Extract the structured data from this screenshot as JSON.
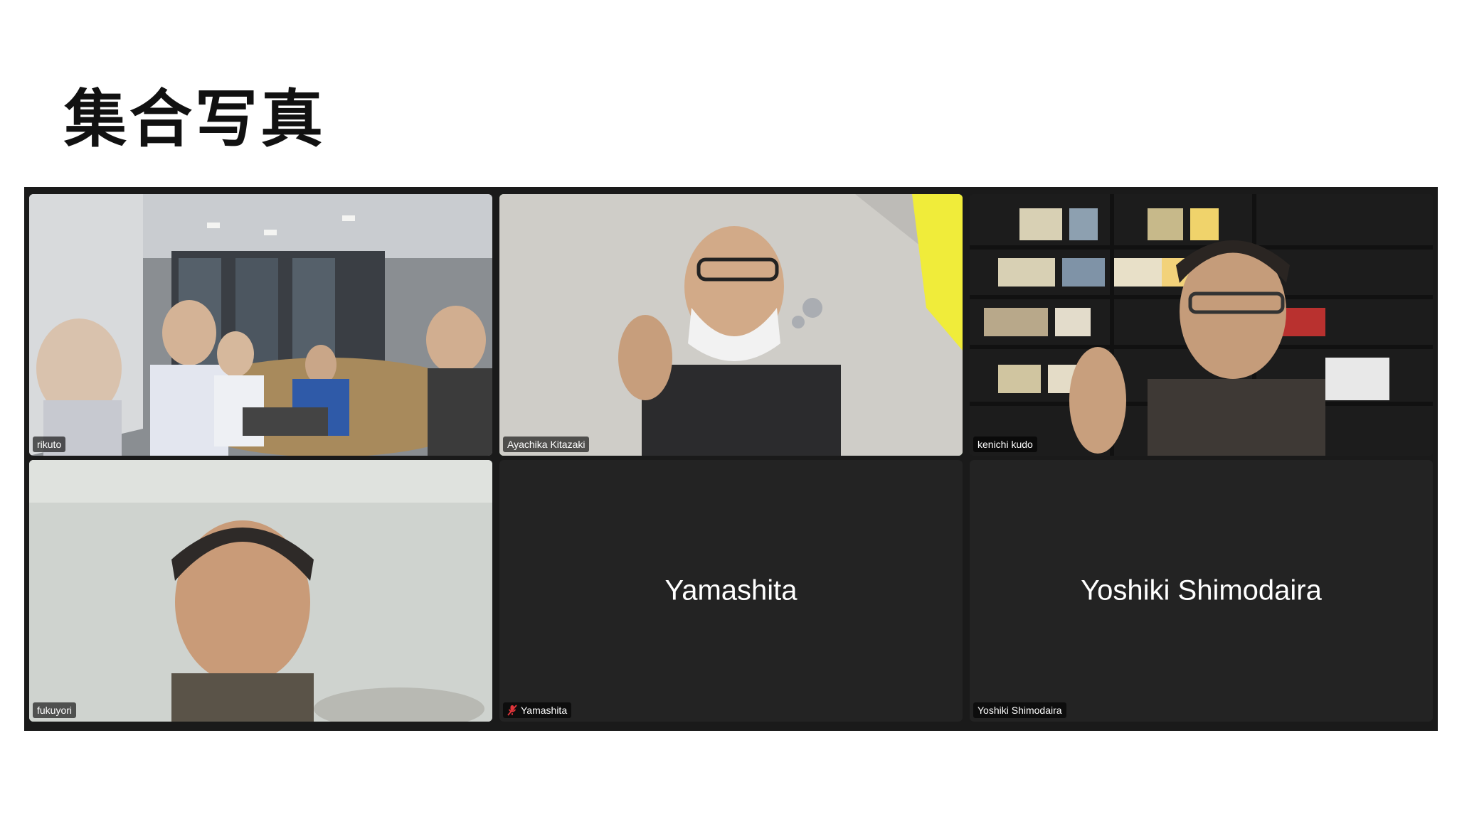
{
  "slide": {
    "title": "集合写真"
  },
  "participants": [
    {
      "name": "rikuto"
    },
    {
      "name": "Ayachika Kitazaki",
      "speaking": true
    },
    {
      "name": "kenichi kudo"
    },
    {
      "name": "fukuyori"
    },
    {
      "name": "Yamashita",
      "display_name": "Yamashita",
      "muted": true
    },
    {
      "name": "Yoshiki Shimodaira",
      "display_name": "Yoshiki Shimodaira"
    }
  ],
  "colors": {
    "active_speaker_border": "#2ec64a",
    "tile_background": "#232323",
    "gallery_background": "#1a1a1a",
    "muted_icon": "#e0353b"
  },
  "icons": {
    "muted": "microphone-muted-icon"
  }
}
